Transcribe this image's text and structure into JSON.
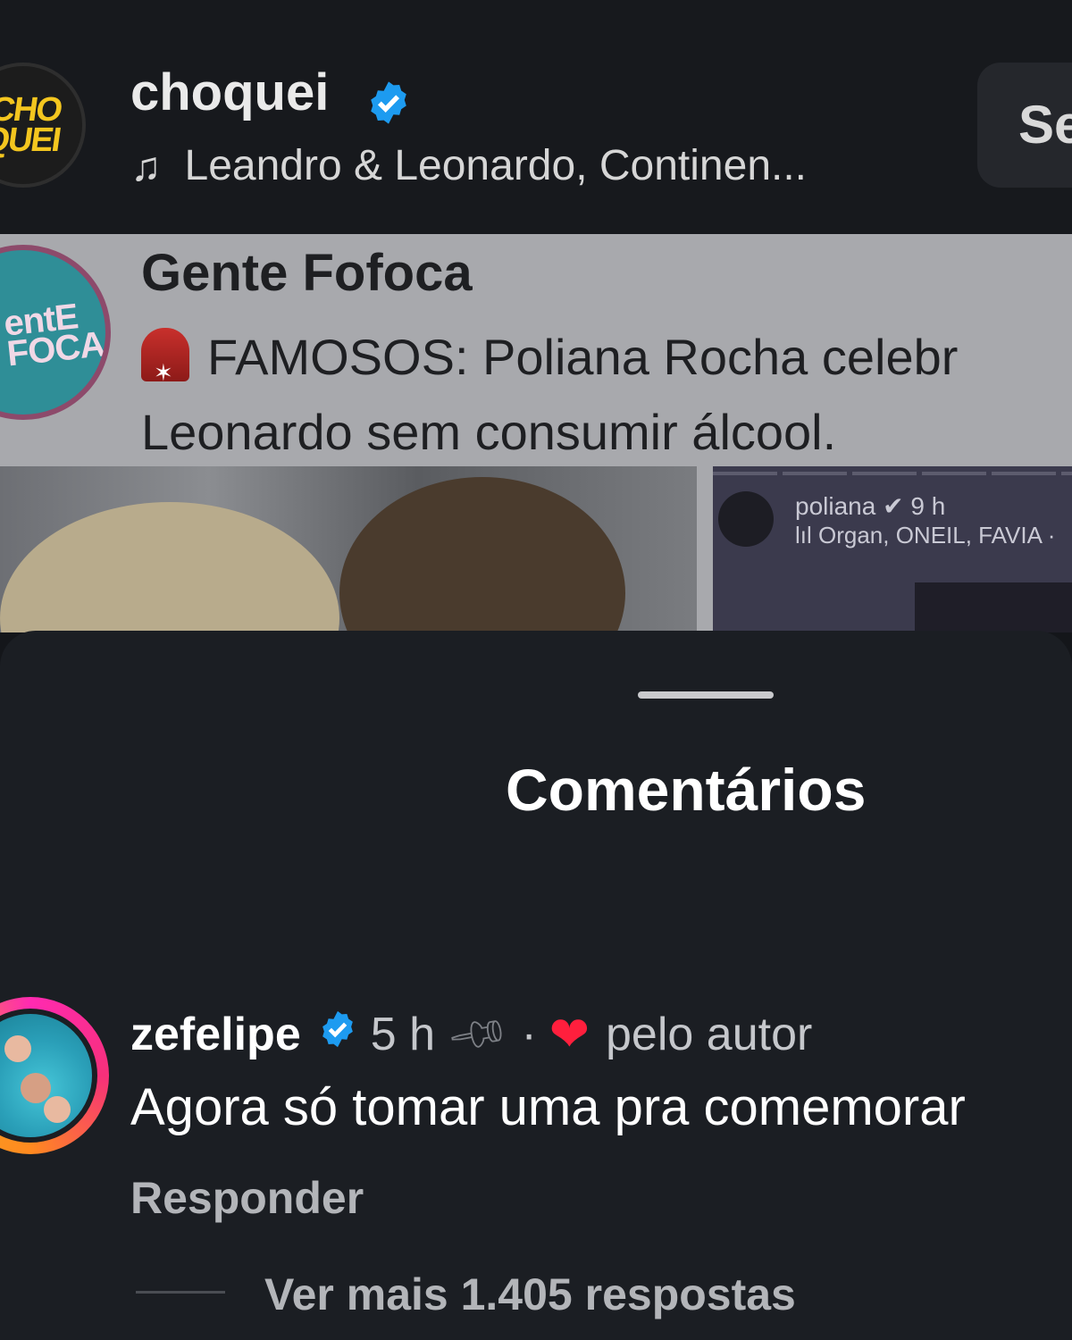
{
  "post": {
    "account_name": "choquei",
    "avatar_logo_line1": "CHO",
    "avatar_logo_line2": "QUEI",
    "music": "Leandro & Leonardo, Continen...",
    "follow_label": "Se"
  },
  "shared_post": {
    "source_name": "Gente Fofoca",
    "avatar_logo_line1": "entE",
    "avatar_logo_line2": "FOCA",
    "headline_line1": "FAMOSOS: Poliana Rocha celebr",
    "headline_line2": "Leonardo sem consumir álcool.",
    "story": {
      "user": "poliana",
      "time": "9 h",
      "music": "Organ, ONEIL, FAVIA ·"
    }
  },
  "comments_sheet": {
    "title": "Comentários",
    "comment": {
      "username": "zefelipe",
      "time": "5 h",
      "separator": "·",
      "liked_by": "pelo autor",
      "text": "Agora só tomar uma pra comemorar",
      "reply_label": "Responder",
      "view_replies": "Ver mais 1.405 respostas"
    }
  },
  "colors": {
    "verified_blue": "#1d9bf0",
    "like_red": "#ff1f3d",
    "sheet_bg": "#1b1e23"
  },
  "icons": [
    "verified-badge-icon",
    "music-note-icon",
    "siren-icon",
    "pin-icon",
    "heart-icon"
  ]
}
